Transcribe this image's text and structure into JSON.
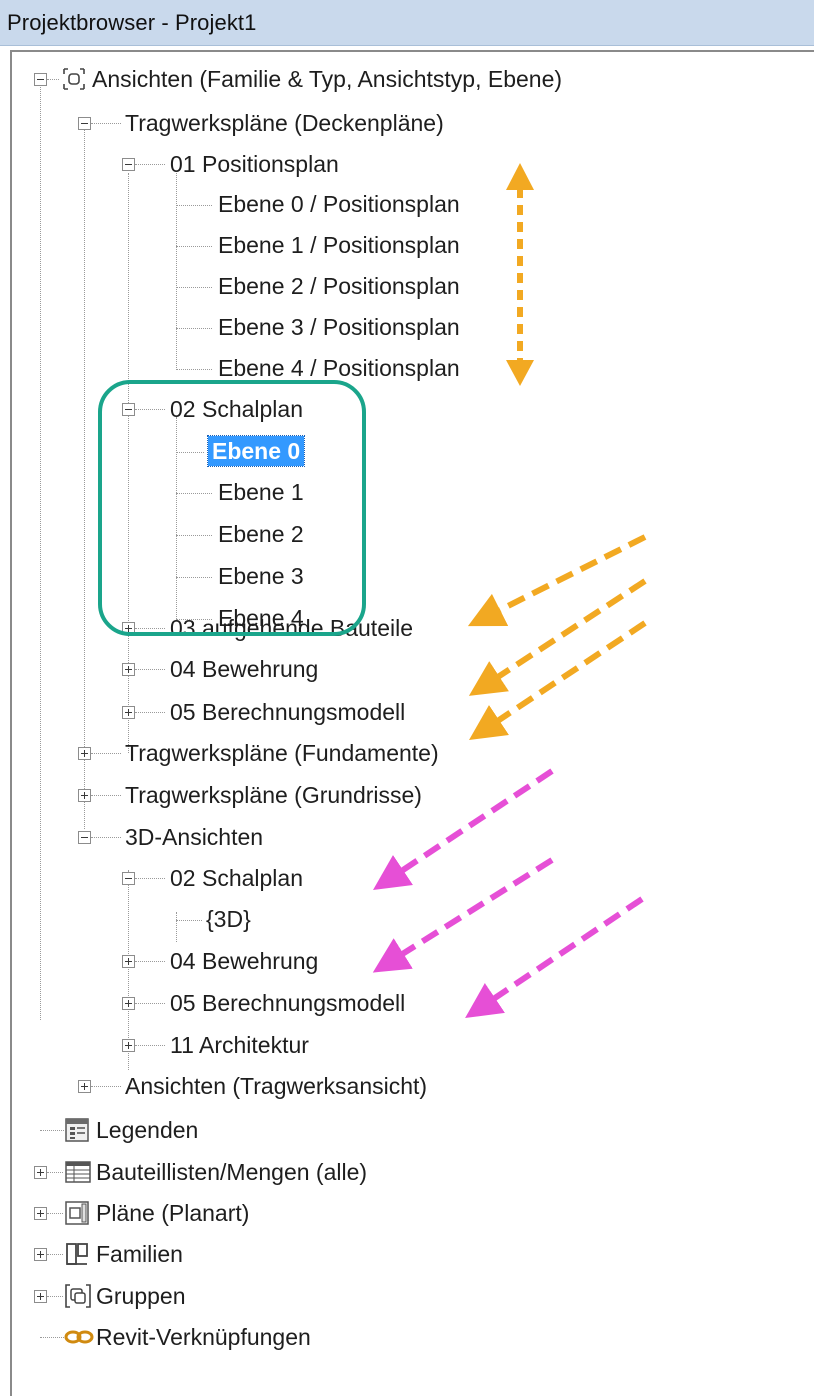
{
  "window": {
    "title": "Projektbrowser - Projekt1"
  },
  "tree": {
    "root": "Ansichten (Familie & Typ, Ansichtstyp, Ebene)",
    "tragwerk_decken": "Tragwerkspläne (Deckenpläne)",
    "positionsplan": "01 Positionsplan",
    "pos_items": [
      "Ebene 0 / Positionsplan",
      "Ebene 1 / Positionsplan",
      "Ebene 2 / Positionsplan",
      "Ebene 3 / Positionsplan",
      "Ebene 4 / Positionsplan"
    ],
    "schalplan": "02 Schalplan",
    "schal_items": [
      "Ebene 0",
      "Ebene 1",
      "Ebene 2",
      "Ebene 3",
      "Ebene 4"
    ],
    "aufgehend": "03 aufgehende Bauteile",
    "bewehrung": "04 Bewehrung",
    "berechnung": "05 Berechnungsmodell",
    "fundamente": "Tragwerkspläne (Fundamente)",
    "grundrisse": "Tragwerkspläne (Grundrisse)",
    "ansichten3d": "3D-Ansichten",
    "schalplan3d": "02 Schalplan",
    "item3d": "{3D}",
    "bewehrung3d": "04 Bewehrung",
    "berechnung3d": "05 Berechnungsmodell",
    "architektur": "11 Architektur",
    "tragwerksansicht": "Ansichten (Tragwerksansicht)",
    "legenden": "Legenden",
    "bauteillisten": "Bauteillisten/Mengen (alle)",
    "plaene": "Pläne (Planart)",
    "familien": "Familien",
    "gruppen": "Gruppen",
    "verknuepfungen": "Revit-Verknüpfungen"
  },
  "selected": "schal_items.0",
  "colors": {
    "titlebar": "#c9d9ec",
    "selection": "#3399ff",
    "highlight_box": "#1aa58b",
    "arrow_orange": "#f2a922",
    "arrow_magenta": "#e64fd6"
  }
}
